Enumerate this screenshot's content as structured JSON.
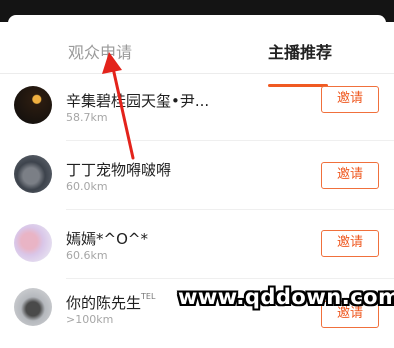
{
  "tabs": [
    {
      "label": "观众申请"
    },
    {
      "label": "主播推荐"
    }
  ],
  "active_tab": 1,
  "accent_color": "#f05a22",
  "rows": [
    {
      "name": "辛集碧桂园天玺•尹...",
      "distance": "58.7km",
      "invite": "邀请"
    },
    {
      "name": "丁丁宠物嘚啵嘚",
      "distance": "60.0km",
      "invite": "邀请"
    },
    {
      "name": "嫣嫣*^O^*",
      "distance": "60.6km",
      "invite": "邀请"
    },
    {
      "name": "你的陈先生",
      "name_suffix": "TEL",
      "distance": ">100km",
      "invite": "邀请"
    }
  ],
  "watermark": {
    "text": "www.qddown.com"
  }
}
